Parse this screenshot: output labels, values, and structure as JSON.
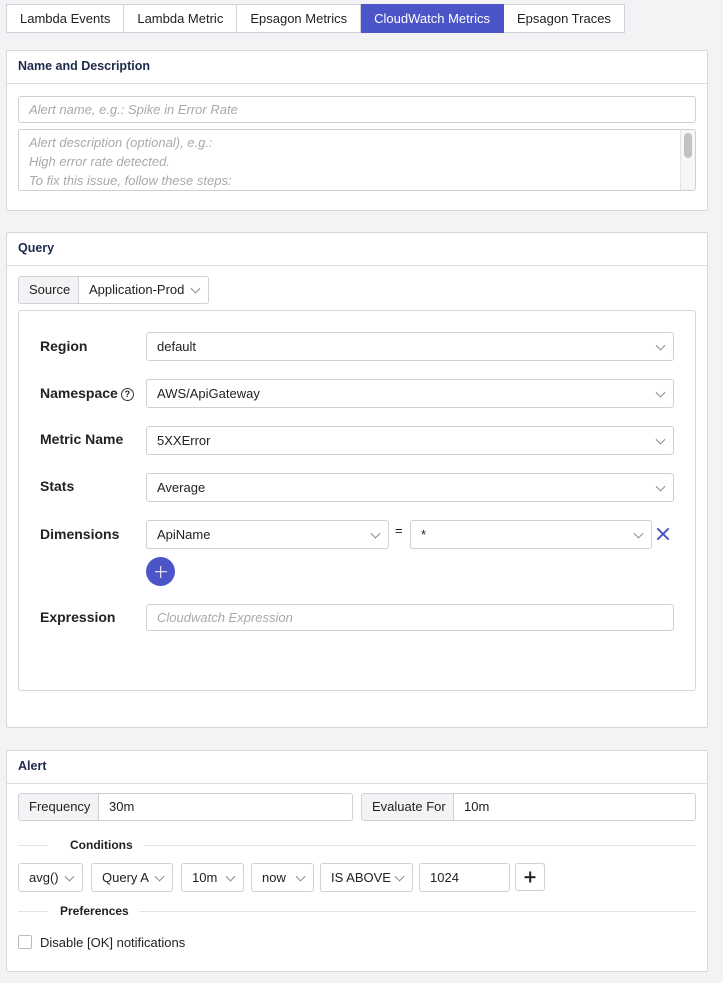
{
  "tabs": [
    {
      "label": "Lambda Events",
      "active": false
    },
    {
      "label": "Lambda Metric",
      "active": false
    },
    {
      "label": "Epsagon Metrics",
      "active": false
    },
    {
      "label": "CloudWatch Metrics",
      "active": true
    },
    {
      "label": "Epsagon Traces",
      "active": false
    }
  ],
  "name_section": {
    "title": "Name and Description",
    "name_placeholder": "Alert name, e.g.: Spike in Error Rate",
    "description_placeholder_lines": [
      "Alert description  (optional), e.g.:",
      "High error rate detected.",
      "To fix this issue, follow these steps:"
    ]
  },
  "query_section": {
    "title": "Query",
    "source_label": "Source",
    "source_value": "Application-Prod",
    "region_label": "Region",
    "region_value": "default",
    "namespace_label": "Namespace",
    "namespace_help": "?",
    "namespace_value": "AWS/ApiGateway",
    "metric_label": "Metric Name",
    "metric_value": "5XXError",
    "stats_label": "Stats",
    "stats_value": "Average",
    "dimensions_label": "Dimensions",
    "dimension_key": "ApiName",
    "dimension_eq": "=",
    "dimension_value": "*",
    "expression_label": "Expression",
    "expression_placeholder": "Cloudwatch Expression"
  },
  "alert_section": {
    "title": "Alert",
    "frequency_label": "Frequency",
    "frequency_value": "30m",
    "evaluate_label": "Evaluate For",
    "evaluate_value": "10m",
    "conditions_title": "Conditions",
    "cond_func": "avg()",
    "cond_query": "Query A",
    "cond_window": "10m",
    "cond_end": "now",
    "cond_operator": "IS ABOVE",
    "cond_threshold": "1024",
    "preferences_title": "Preferences",
    "disable_ok_label": "Disable [OK] notifications"
  },
  "colors": {
    "accent": "#4c55c8"
  }
}
